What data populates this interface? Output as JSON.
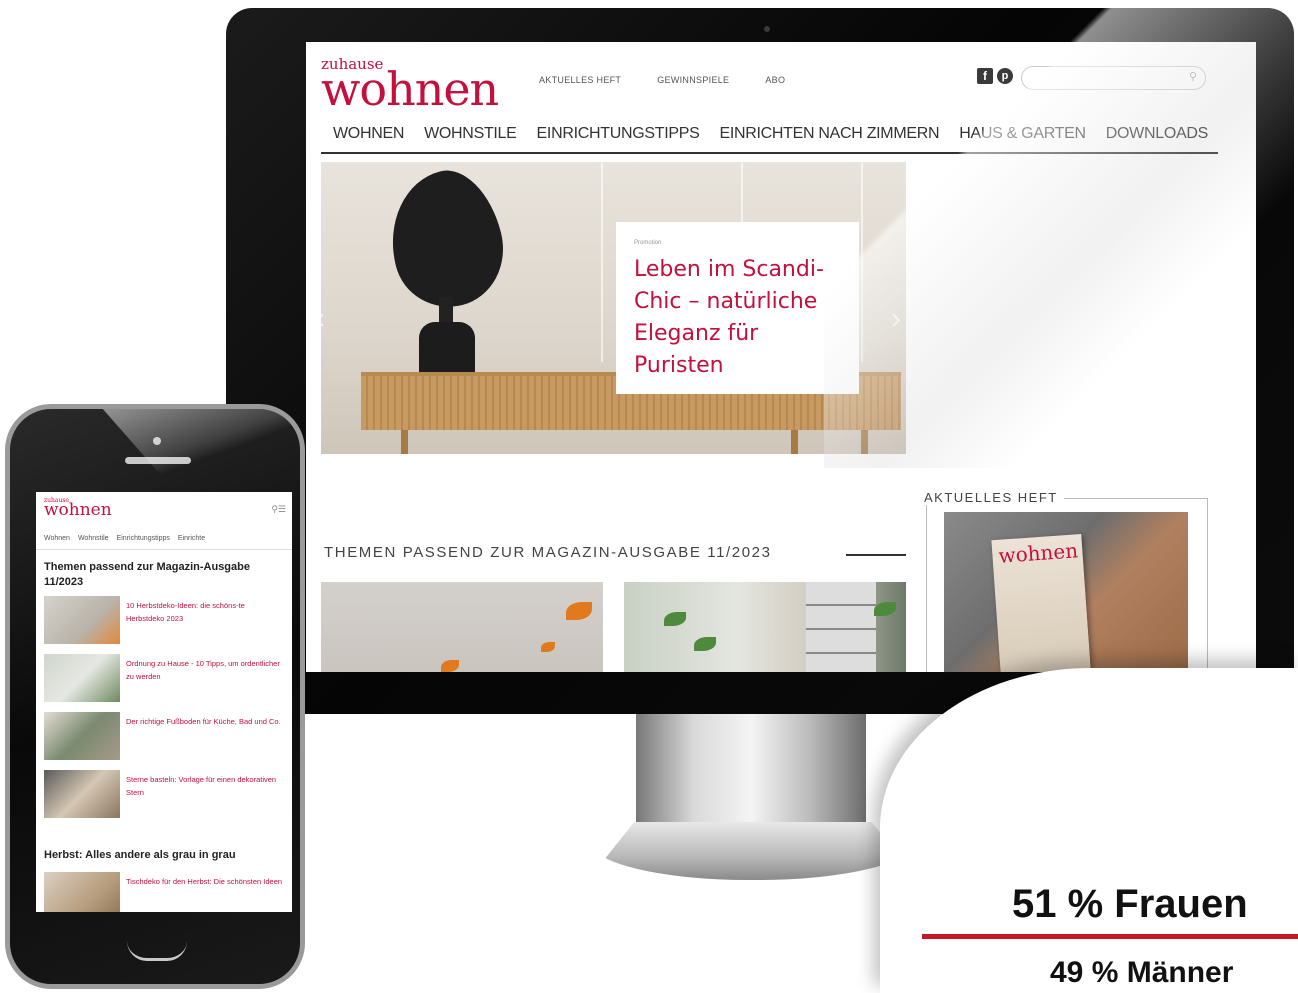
{
  "desktop": {
    "logo_small": "zuhause",
    "logo": "wohnen",
    "top_links": [
      "AKTUELLES HEFT",
      "GEWINNSPIELE",
      "ABO"
    ],
    "search_placeholder": "",
    "nav": [
      "WOHNEN",
      "WOHNSTILE",
      "EINRICHTUNGSTIPPS",
      "EINRICHTEN NACH ZIMMERN",
      "HAUS & GARTEN",
      "DOWNLOADS"
    ],
    "hero": {
      "kicker": "Promotion",
      "title": "Leben im Scandi-Chic – natürliche Eleganz für Puristen"
    },
    "aktuelles_heft": "AKTUELLES HEFT",
    "cover_logo": "wohnen",
    "themen_heading": "THEMEN PASSEND ZUR MAGAZIN-AUSGABE 11/2023"
  },
  "mobile": {
    "logo_small": "zuhause",
    "logo": "wohnen",
    "nav": [
      "Wohnen",
      "Wohnstile",
      "Einrichtungstipps",
      "Einrichte"
    ],
    "heading_1": "Themen passend zur Magazin-Ausgabe 11/2023",
    "items": [
      {
        "text": "10 Herbstdeko-Ideen: die schöns-te Herbstdeko 2023"
      },
      {
        "text": "Ordnung zu Hause - 10 Tipps, um ordentlicher zu werden"
      },
      {
        "text": "Der richtige Fußboden für Küche, Bad und Co."
      },
      {
        "text": "Sterne basteln: Vorlage für einen dekorativen Stern"
      }
    ],
    "heading_2": "Herbst: Alles andere als grau in grau",
    "item_5": {
      "text": "Tischdeko für den Herbst: Die schönsten Ideen"
    }
  },
  "stats": {
    "women": "51 % Frauen",
    "men": "49 % Männer"
  },
  "colors": {
    "brand": "#c4103d",
    "accent_line": "#c81825"
  }
}
